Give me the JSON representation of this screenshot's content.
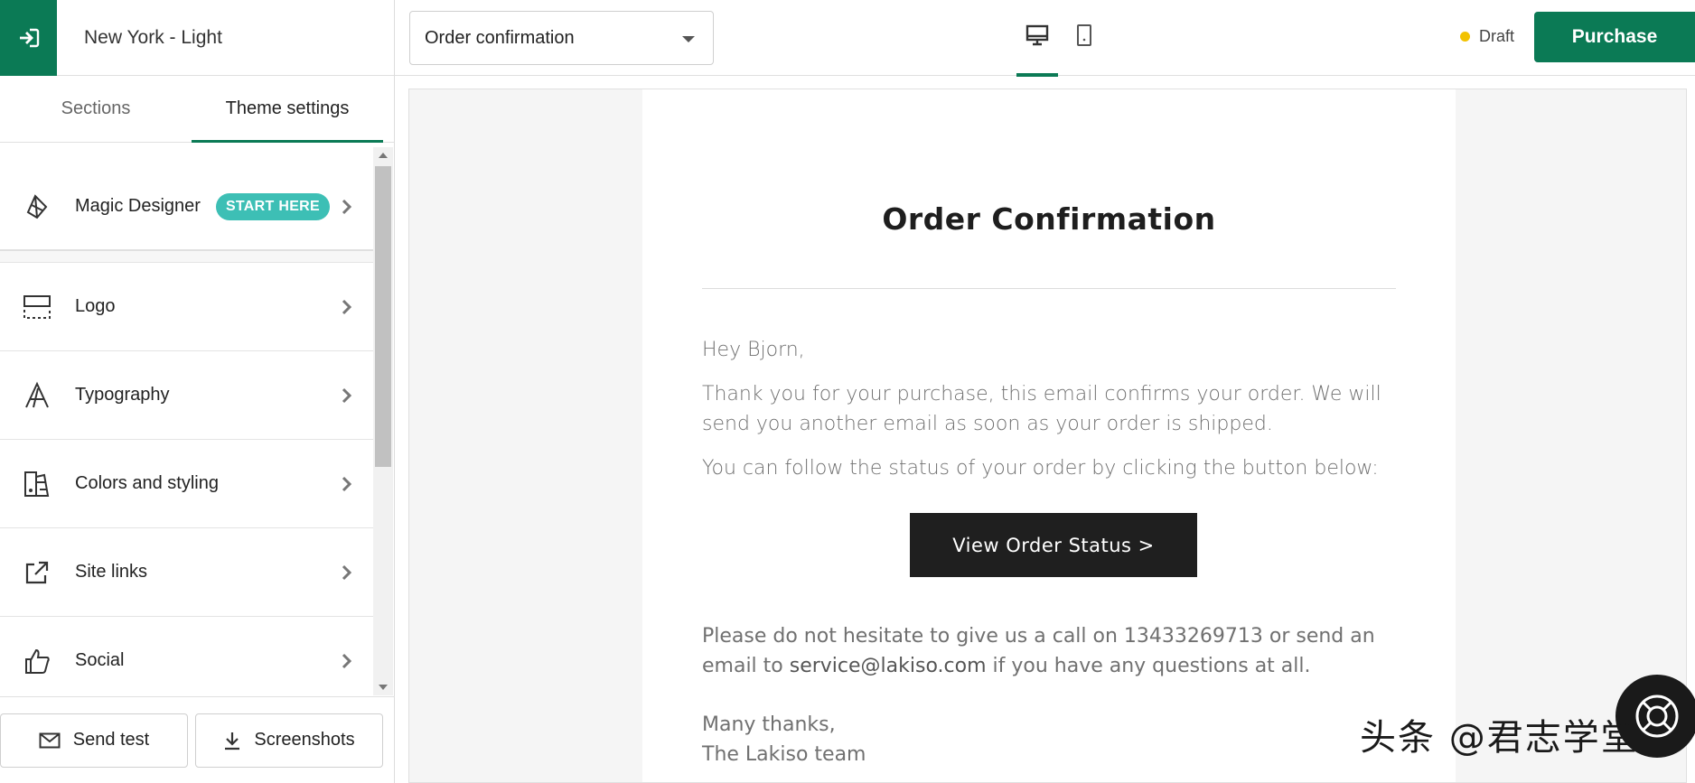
{
  "sidebar": {
    "theme_name": "New York - Light",
    "tabs": [
      {
        "label": "Sections",
        "active": false
      },
      {
        "label": "Theme settings",
        "active": true
      }
    ],
    "items": [
      {
        "label": "Magic Designer",
        "icon": "magic-designer-icon",
        "badge": "START HERE"
      },
      {
        "label": "Logo",
        "icon": "logo-frame-icon"
      },
      {
        "label": "Typography",
        "icon": "typography-icon"
      },
      {
        "label": "Colors and styling",
        "icon": "palette-icon"
      },
      {
        "label": "Site links",
        "icon": "external-link-icon"
      },
      {
        "label": "Social",
        "icon": "thumbs-up-icon"
      }
    ],
    "bottom": {
      "send_test": "Send test",
      "screenshots": "Screenshots"
    }
  },
  "topbar": {
    "template_select": "Order confirmation",
    "status": "Draft",
    "purchase_label": "Purchase"
  },
  "email": {
    "title": "Order Confirmation",
    "greeting": "Hey Bjorn,",
    "para1": "Thank you for your purchase, this email confirms your order. We will send you another email as soon as your order is shipped.",
    "para2": "You can follow the status of your order by clicking the button below:",
    "button": "View Order Status >",
    "para3_prefix": "Please do not hesitate to give us a call on 13433269713 or send an email to ",
    "email_link": "service@lakiso.com",
    "para3_suffix": " if you have any questions at all.",
    "sign1": "Many thanks,",
    "sign2": "The Lakiso team"
  },
  "watermark": "头条 @君志学堂",
  "colors": {
    "accent": "#0b7a55",
    "badge": "#3dbfb5",
    "draft_dot": "#f2c200"
  }
}
